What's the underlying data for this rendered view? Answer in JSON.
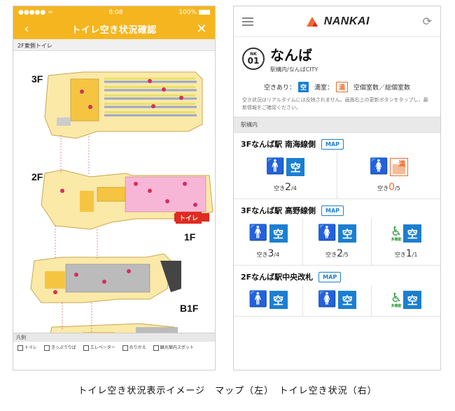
{
  "left_phone": {
    "status": {
      "carrier": "●●●●● ",
      "time": "8:08",
      "battery": "100%"
    },
    "title": "トイレ空き状況確認",
    "back_icon": "chevron-left-icon",
    "close_icon": "close-icon",
    "subheader": "2F東側トイレ",
    "floors": [
      "3F",
      "2F",
      "1F",
      "B1F"
    ],
    "toilet_tag": "トイレ",
    "legend": {
      "heading": "凡例",
      "items": [
        "トイレ",
        "きっぷうりば",
        "エレベーター",
        "のりかえ",
        "観光案内スポット"
      ]
    }
  },
  "right_phone": {
    "logo": "NANKAI",
    "station": {
      "line_code": "NK",
      "number": "01",
      "name": "なんば",
      "sub": "駅構内/なんばCITY"
    },
    "legend": {
      "vacant_label": "空きあり：",
      "vacant_chip": "空",
      "full_label": "満室：",
      "full_chip": "満",
      "ratio_label": "空個室数／総個室数"
    },
    "notice": "空き状況はリアルタイムには反映されません。画面右上の更新ボタンをタップし、最新情報をご確認ください。",
    "section": "駅構内",
    "map_button": "MAP",
    "areas": [
      {
        "title": "3Fなんば駅 南海線側",
        "stalls": [
          {
            "type": "male",
            "status": "空",
            "count_label": "空き",
            "free": "2",
            "total": "/4"
          },
          {
            "type": "female",
            "status": "満",
            "count_label": "空き",
            "free": "0",
            "total": "/5"
          }
        ]
      },
      {
        "title": "3Fなんば駅 高野線側",
        "stalls": [
          {
            "type": "male",
            "status": "空",
            "count_label": "空き",
            "free": "3",
            "total": "/4"
          },
          {
            "type": "female",
            "status": "空",
            "count_label": "空き",
            "free": "2",
            "total": "/5"
          },
          {
            "type": "accessible",
            "status": "空",
            "count_label": "空き",
            "free": "1",
            "total": "/1",
            "sub": "多機能"
          }
        ]
      },
      {
        "title": "2Fなんば駅中央改札",
        "stalls": [
          {
            "type": "male",
            "status": "空"
          },
          {
            "type": "female",
            "status": "空"
          },
          {
            "type": "accessible",
            "status": "空",
            "sub": "多機能"
          }
        ]
      }
    ]
  },
  "caption": "トイレ空き状況表示イメージ　マップ（左）　トイレ空き状況（右）",
  "colors": {
    "header_yellow": "#f5b51f",
    "vacant_blue": "#1b7fd1",
    "full_orange": "#f06a2b",
    "male_blue": "#1b7fd1",
    "female_red": "#d8281c",
    "accessible_green": "#2a9b3b",
    "map_tag_red": "#e02b20"
  }
}
